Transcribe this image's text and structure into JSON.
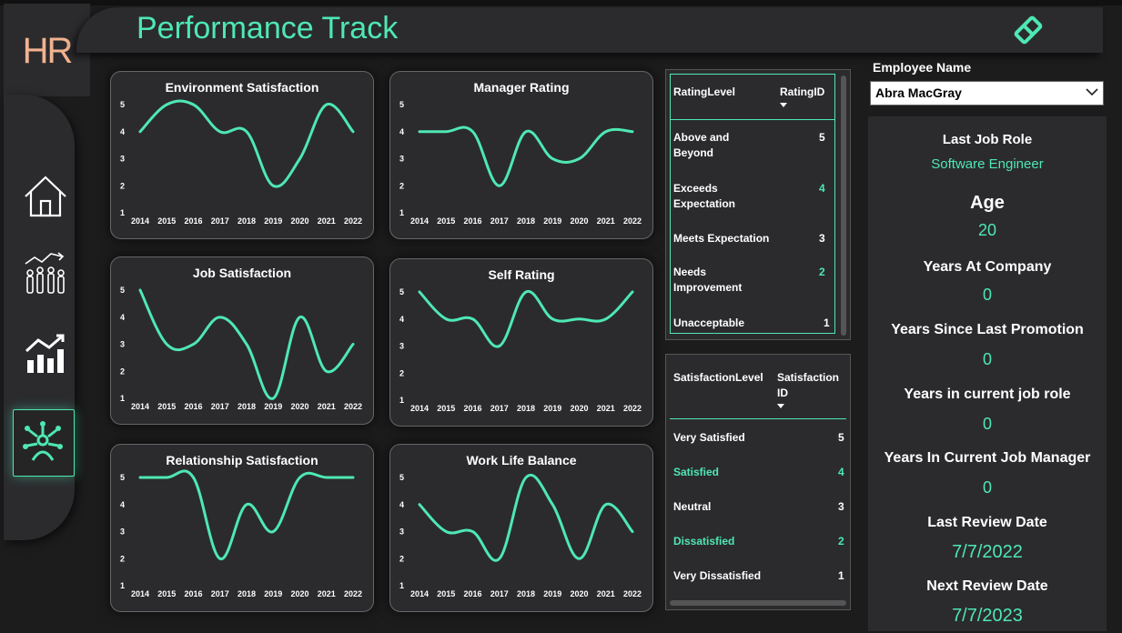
{
  "app": {
    "logo": "HR",
    "title": "Performance Track"
  },
  "colors": {
    "accent": "#4ee8b2",
    "logo": "#f2b38f",
    "card_bg": "#2b2b2e"
  },
  "nav": [
    {
      "name": "home",
      "icon": "home-icon"
    },
    {
      "name": "people-growth",
      "icon": "people-growth-icon"
    },
    {
      "name": "analytics",
      "icon": "bar-chart-icon"
    },
    {
      "name": "network",
      "icon": "network-icon",
      "active": true
    }
  ],
  "header_icon": "eraser-icon",
  "chart_data": [
    {
      "type": "line",
      "title": "Environment Satisfaction",
      "x": [
        2014,
        2015,
        2016,
        2017,
        2018,
        2019,
        2020,
        2021,
        2022
      ],
      "values": [
        4,
        5,
        5,
        4,
        4,
        2,
        3,
        5,
        4
      ],
      "ylim": [
        1,
        5
      ]
    },
    {
      "type": "line",
      "title": "Manager Rating",
      "x": [
        2014,
        2015,
        2016,
        2017,
        2018,
        2019,
        2020,
        2021,
        2022
      ],
      "values": [
        4,
        4,
        4,
        2,
        4,
        3,
        3,
        4,
        4
      ],
      "ylim": [
        1,
        5
      ]
    },
    {
      "type": "line",
      "title": "Job Satisfaction",
      "x": [
        2014,
        2015,
        2016,
        2017,
        2018,
        2019,
        2020,
        2021,
        2022
      ],
      "values": [
        5,
        3,
        3,
        4,
        3,
        1,
        4,
        2,
        3
      ],
      "ylim": [
        1,
        5
      ]
    },
    {
      "type": "line",
      "title": "Self Rating",
      "x": [
        2014,
        2015,
        2016,
        2017,
        2018,
        2019,
        2020,
        2021,
        2022
      ],
      "values": [
        5,
        4,
        4,
        3,
        5,
        4,
        4,
        4,
        5
      ],
      "ylim": [
        1,
        5
      ]
    },
    {
      "type": "line",
      "title": "Relationship Satisfaction",
      "x": [
        2014,
        2015,
        2016,
        2017,
        2018,
        2019,
        2020,
        2021,
        2022
      ],
      "values": [
        5,
        5,
        5,
        2,
        4,
        3,
        5,
        5,
        5
      ],
      "ylim": [
        1,
        5
      ]
    },
    {
      "type": "line",
      "title": "Work Life Balance",
      "x": [
        2014,
        2015,
        2016,
        2017,
        2018,
        2019,
        2020,
        2021,
        2022
      ],
      "values": [
        4,
        3,
        3,
        2,
        5,
        4,
        2,
        4,
        3
      ],
      "ylim": [
        1,
        5
      ]
    }
  ],
  "rating_table": {
    "headers": [
      "RatingLevel",
      "RatingID"
    ],
    "rows": [
      {
        "level": "Above and Beyond",
        "id": "5"
      },
      {
        "level": "Exceeds Expectation",
        "id": "4"
      },
      {
        "level": "Meets Expectation",
        "id": "3"
      },
      {
        "level": "Needs Improvement",
        "id": "2"
      },
      {
        "level": "Unacceptable",
        "id": "1"
      }
    ]
  },
  "satisfaction_table": {
    "headers": [
      "SatisfactionLevel",
      "Satisfaction ID"
    ],
    "rows": [
      {
        "level": "Very Satisfied",
        "id": "5"
      },
      {
        "level": "Satisfied",
        "id": "4"
      },
      {
        "level": "Neutral",
        "id": "3"
      },
      {
        "level": "Dissatisfied",
        "id": "2"
      },
      {
        "level": "Very Dissatisfied",
        "id": "1"
      }
    ]
  },
  "employee": {
    "label": "Employee Name",
    "selected": "Abra MacGray",
    "fields": [
      {
        "label": "Last Job Role",
        "value": "Software Engineer"
      },
      {
        "label": "Age",
        "value": "20"
      },
      {
        "label": "Years At Company",
        "value": "0"
      },
      {
        "label": "Years Since Last Promotion",
        "value": "0"
      },
      {
        "label": "Years in current job role",
        "value": "0"
      },
      {
        "label": "Years In Current Job Manager",
        "value": "0"
      },
      {
        "label": "Last Review Date",
        "value": "7/7/2022"
      },
      {
        "label": "Next Review Date",
        "value": "7/7/2023"
      }
    ]
  }
}
